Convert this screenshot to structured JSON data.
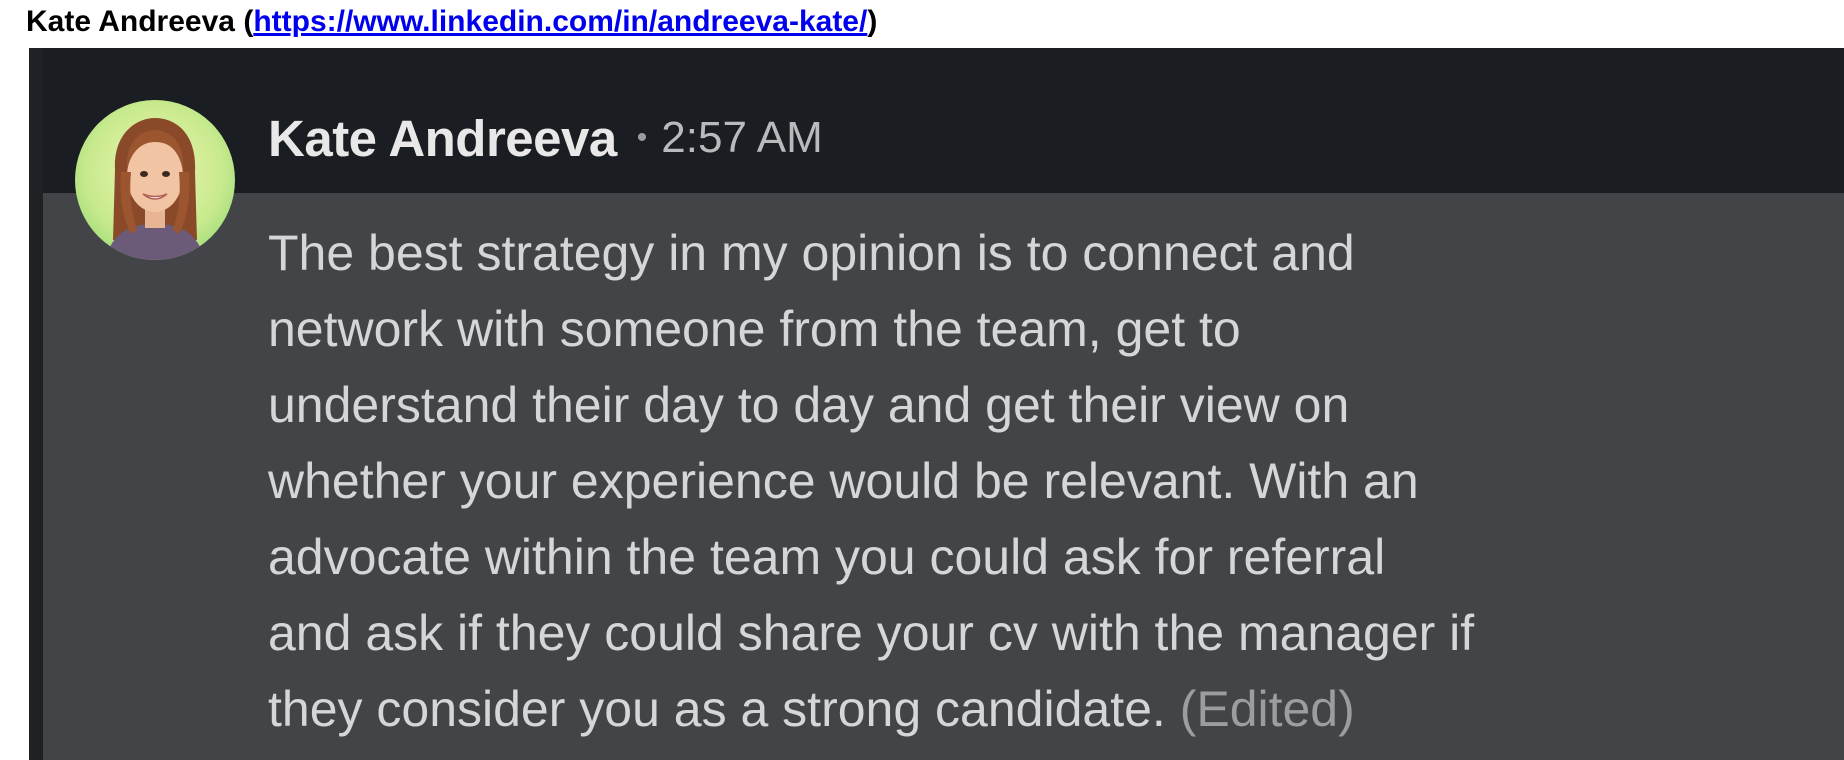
{
  "caption": {
    "name": "Kate Andreeva",
    "open_paren": " (",
    "link": "https://www.linkedin.com/in/andreeva-kate/",
    "close_paren": ")"
  },
  "message": {
    "author": "Kate Andreeva",
    "separator": "•",
    "time": "2:57 AM",
    "lines": [
      "The best strategy in my opinion is to connect and",
      "network with someone from the team, get to",
      "understand their day to day and get their view on",
      "whether your experience would be relevant. With an",
      "advocate within the team you could ask for referral",
      "and ask if they could share your cv with the manager if",
      "they consider you as a strong candidate."
    ],
    "edited_label": "(Edited)"
  },
  "colors": {
    "background": "#1a1d21",
    "highlight": "#424447",
    "author_text": "#e8e8e8",
    "body_text": "#d5d6d7",
    "link": "#0000ee"
  },
  "icons": {
    "avatar": "profile-photo-avatar"
  }
}
